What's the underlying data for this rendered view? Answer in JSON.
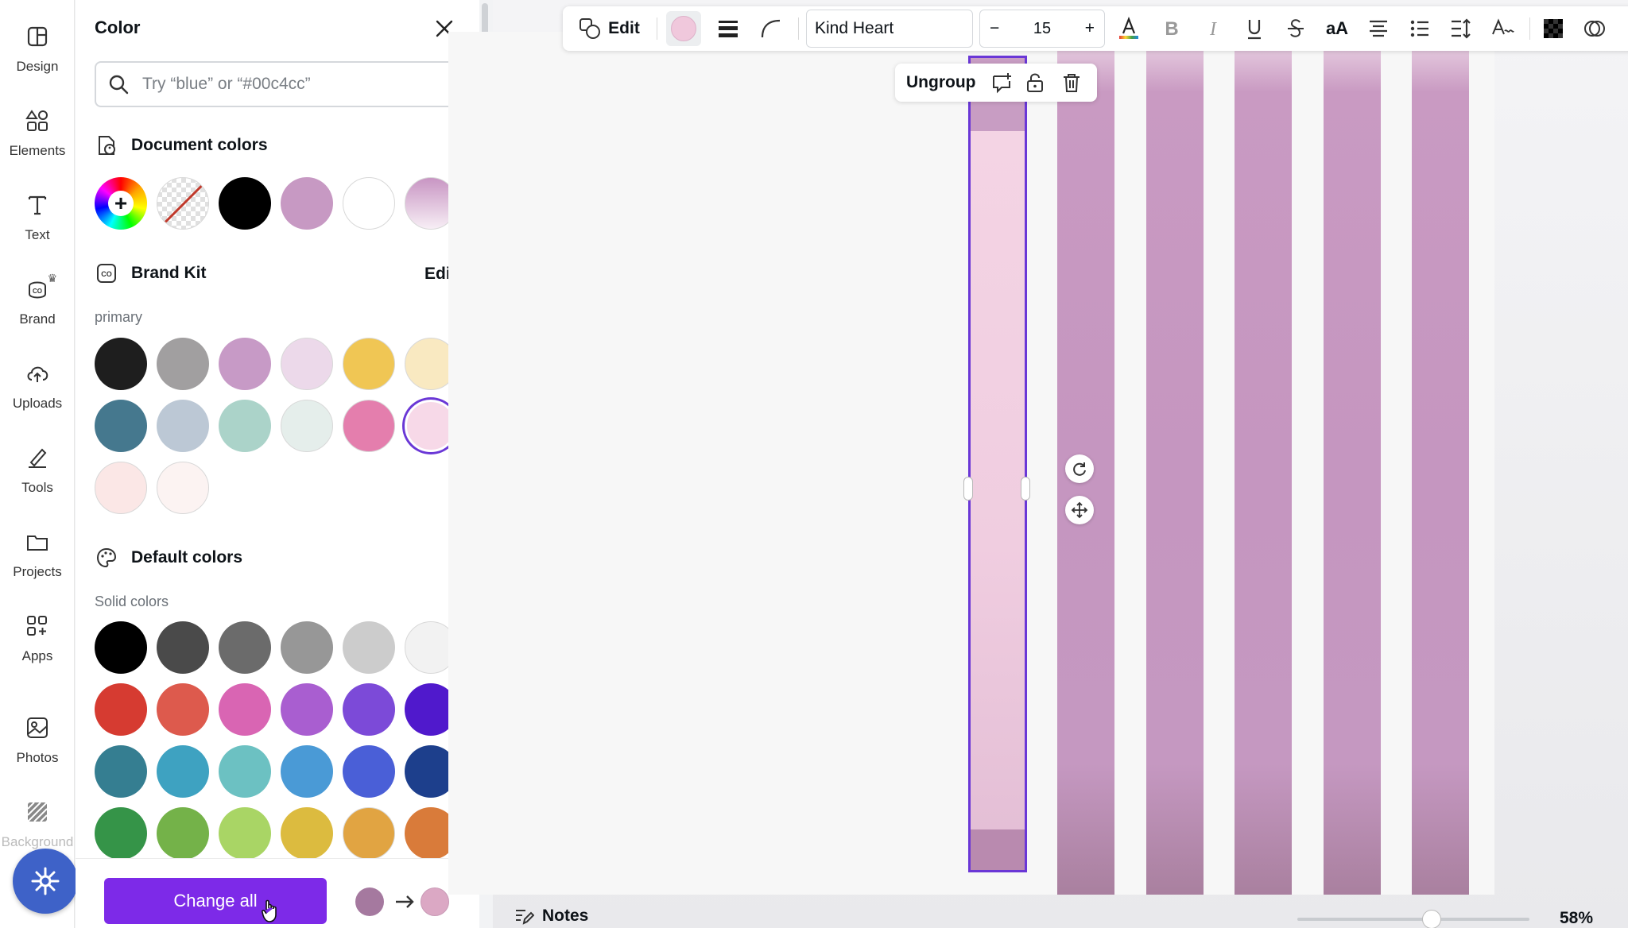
{
  "rail": {
    "items": [
      {
        "label": "Design",
        "icon": "design-icon"
      },
      {
        "label": "Elements",
        "icon": "elements-icon"
      },
      {
        "label": "Text",
        "icon": "text-icon"
      },
      {
        "label": "Brand",
        "icon": "brand-icon"
      },
      {
        "label": "Uploads",
        "icon": "uploads-icon"
      },
      {
        "label": "Tools",
        "icon": "tools-icon"
      },
      {
        "label": "Projects",
        "icon": "projects-icon"
      },
      {
        "label": "Apps",
        "icon": "apps-icon"
      },
      {
        "label": "Photos",
        "icon": "photos-icon"
      },
      {
        "label": "Background",
        "icon": "background-icon"
      }
    ]
  },
  "panel": {
    "title": "Color",
    "search_placeholder": "Try “blue” or “#00c4cc”",
    "document_colors": {
      "heading": "Document colors",
      "swatches": [
        "add-color",
        "transparent",
        "#000000",
        "#c799c3",
        "#ffffff",
        "gradient-pink"
      ]
    },
    "brand_kit": {
      "heading": "Brand Kit",
      "edit_label": "Edit",
      "primary_label": "primary",
      "swatches": [
        "#1e1e1e",
        "#a19fa0",
        "#c79ac6",
        "#ecd9ea",
        "#f0c654",
        "#f9e9c1",
        "#45788e",
        "#bcc8d5",
        "#abd3c9",
        "#e5eeeb",
        "#e47ead",
        "#f7d9e8",
        "#fbe7e6",
        "#fcf3f2"
      ],
      "selected_index": 11
    },
    "default_colors": {
      "heading": "Default colors",
      "solid_label": "Solid colors",
      "swatches": [
        "#000000",
        "#4a4a4a",
        "#6b6b6b",
        "#979797",
        "#cccccc",
        "#f2f2f2",
        "#d63b31",
        "#dd5a4d",
        "#d965b3",
        "#a95ed0",
        "#7c4ad8",
        "#5019cc",
        "#357e91",
        "#3ea2c1",
        "#6cc1c2",
        "#4a9ad6",
        "#4a5fd7",
        "#1d3f8c",
        "#359448",
        "#74b249",
        "#a9d565",
        "#dcbb3f",
        "#e1a442",
        "#d97b3a"
      ]
    },
    "footer": {
      "change_all_label": "Change all",
      "from_color": "#a5799f",
      "to_color": "#dba8c4"
    }
  },
  "toolbar": {
    "edit_label": "Edit",
    "fill_color": "#f0c8dc",
    "font_name": "Kind Heart",
    "font_size": "15",
    "minus": "−",
    "plus": "+",
    "case_label": "aA"
  },
  "context_menu": {
    "ungroup_label": "Ungroup"
  },
  "bottom": {
    "notes_label": "Notes",
    "zoom_label": "58%",
    "zoom_level": 0.58
  },
  "colors": {
    "accent": "#7d2ae8",
    "selection": "#6a37d6",
    "stripe": "#c596c0"
  }
}
